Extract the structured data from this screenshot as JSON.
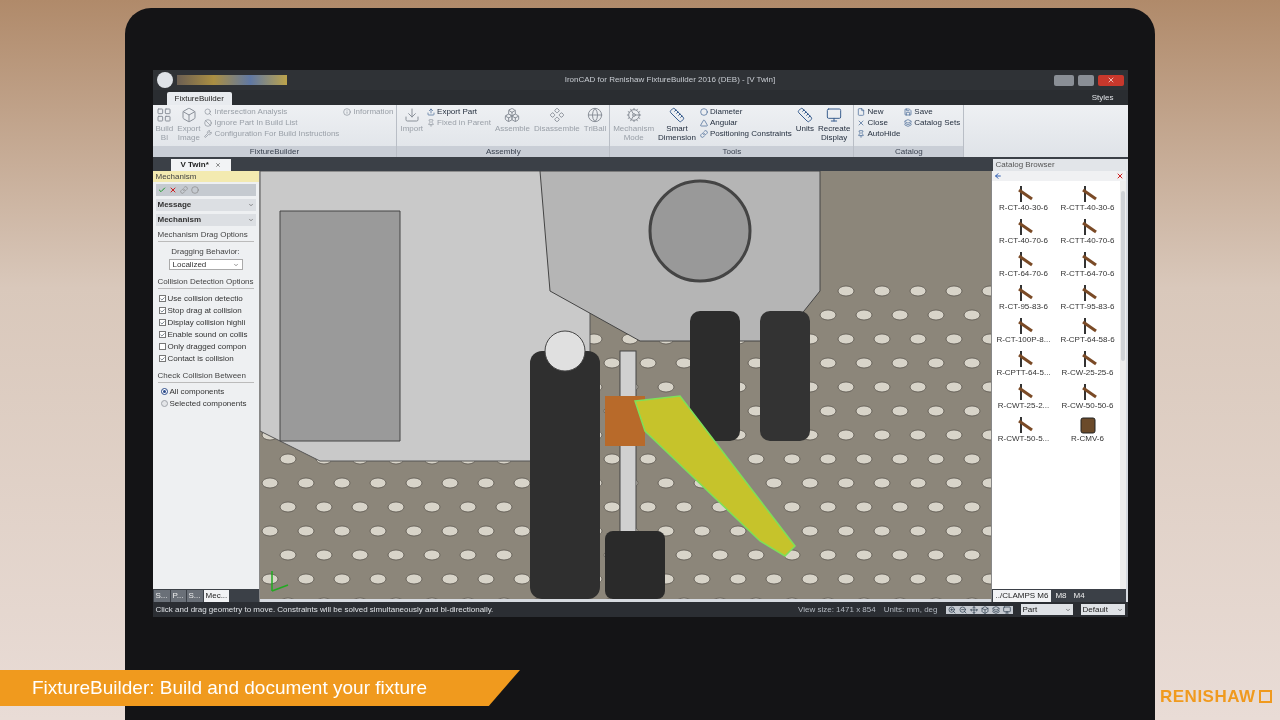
{
  "window": {
    "title": "IronCAD for Renishaw FixtureBuilder 2016 (DEB) - [V Twin]"
  },
  "ribbon": {
    "tabs": [
      {
        "label": "FixtureBuilder",
        "selected": true
      }
    ],
    "styles_label": "Styles",
    "groups": [
      {
        "label": "FixtureBuilder",
        "items": [
          {
            "kind": "large",
            "label": "Build\nBl",
            "disabled": true
          },
          {
            "kind": "large",
            "label": "Export\nImage",
            "disabled": true
          },
          {
            "kind": "small",
            "label": "Intersection Analysis",
            "disabled": true
          },
          {
            "kind": "small",
            "label": "Ignore Part In Build List",
            "disabled": true
          },
          {
            "kind": "small",
            "label": "Configuration For Build Instructions",
            "disabled": true
          },
          {
            "kind": "small",
            "label": "Information",
            "disabled": true
          }
        ]
      },
      {
        "label": "Assembly",
        "items": [
          {
            "kind": "large",
            "label": "Import",
            "disabled": true
          },
          {
            "kind": "small",
            "label": "Export Part",
            "disabled": false
          },
          {
            "kind": "small",
            "label": "Fixed in Parent",
            "disabled": true
          },
          {
            "kind": "large",
            "label": "Assemble",
            "disabled": true
          },
          {
            "kind": "large",
            "label": "Disassemble",
            "disabled": true
          },
          {
            "kind": "large",
            "label": "TriBall",
            "disabled": true
          }
        ]
      },
      {
        "label": "Tools",
        "items": [
          {
            "kind": "large",
            "label": "Mechanism\nMode",
            "disabled": true
          },
          {
            "kind": "large",
            "label": "Smart\nDimension",
            "disabled": false
          },
          {
            "kind": "small",
            "label": "Diameter",
            "disabled": false
          },
          {
            "kind": "small",
            "label": "Angular",
            "disabled": false
          },
          {
            "kind": "small",
            "label": "Positioning Constraints",
            "disabled": false
          },
          {
            "kind": "large",
            "label": "Units",
            "disabled": false
          },
          {
            "kind": "large",
            "label": "Recreate\nDisplay",
            "disabled": false
          }
        ]
      },
      {
        "label": "Catalog",
        "items": [
          {
            "kind": "small",
            "label": "New",
            "disabled": false
          },
          {
            "kind": "small",
            "label": "Close",
            "disabled": false
          },
          {
            "kind": "small",
            "label": "AutoHide",
            "disabled": false
          },
          {
            "kind": "small",
            "label": "Save",
            "disabled": false
          },
          {
            "kind": "small",
            "label": "Catalog Sets",
            "disabled": false
          }
        ]
      }
    ]
  },
  "document_tabs": [
    {
      "label": "V Twin*",
      "selected": true
    }
  ],
  "mechanism_panel": {
    "title": "Mechanism",
    "sections": [
      {
        "label": "Message"
      },
      {
        "label": "Mechanism"
      }
    ],
    "drag_options_heading": "Mechanism Drag Options",
    "dragging_behavior_label": "Dragging Behavior:",
    "dragging_behavior_value": "Localized",
    "collision_heading": "Collision Detection Options",
    "checkboxes": [
      {
        "label": "Use collision detectio",
        "checked": true
      },
      {
        "label": "Stop drag at collision",
        "checked": true
      },
      {
        "label": "Display collision highli",
        "checked": true
      },
      {
        "label": "Enable sound on collis",
        "checked": true
      },
      {
        "label": "Only dragged compon",
        "checked": false
      },
      {
        "label": "Contact is collision",
        "checked": true
      }
    ],
    "check_between_heading": "Check Collision Between",
    "radios": [
      {
        "label": "All components",
        "selected": true
      },
      {
        "label": "Selected components",
        "selected": false
      }
    ],
    "bottom_tabs": [
      {
        "label": "S...",
        "selected": false
      },
      {
        "label": "P...",
        "selected": false
      },
      {
        "label": "S...",
        "selected": false
      },
      {
        "label": "Mec...",
        "selected": true
      }
    ]
  },
  "catalog_browser": {
    "title": "Catalog Browser",
    "items": [
      {
        "label": "R-CT-40-30-6",
        "kind": "clamp"
      },
      {
        "label": "R-CTT-40-30-6",
        "kind": "clamp"
      },
      {
        "label": "R-CT-40-70-6",
        "kind": "clamp"
      },
      {
        "label": "R-CTT-40-70-6",
        "kind": "clamp"
      },
      {
        "label": "R-CT-64-70-6",
        "kind": "clamp"
      },
      {
        "label": "R-CTT-64-70-6",
        "kind": "clamp"
      },
      {
        "label": "R-CT-95-83-6",
        "kind": "clamp"
      },
      {
        "label": "R-CTT-95-83-6",
        "kind": "clamp"
      },
      {
        "label": "R-CT-100P-8...",
        "kind": "clamp"
      },
      {
        "label": "R-CPT-64-58-6",
        "kind": "clamp"
      },
      {
        "label": "R-CPTT-64-5...",
        "kind": "clamp"
      },
      {
        "label": "R-CW-25-25-6",
        "kind": "clamp"
      },
      {
        "label": "R-CWT-25-2...",
        "kind": "clamp"
      },
      {
        "label": "R-CW-50-50-6",
        "kind": "clamp"
      },
      {
        "label": "R-CWT-50-5...",
        "kind": "clamp"
      },
      {
        "label": "R-CMV-6",
        "kind": "block"
      }
    ],
    "tabs": [
      {
        "label": "../CLAMPS M6",
        "selected": true
      },
      {
        "label": "M8",
        "selected": false
      },
      {
        "label": "M4",
        "selected": false
      }
    ]
  },
  "status_bar": {
    "message": "Click and drag geometry to move.  Constraints will be solved simultaneously and bi-directionally.",
    "view_size": "View size: 1471 x 854",
    "units": "Units: mm, deg",
    "part_select": "Part",
    "default_select": "Default"
  },
  "banner": {
    "text": "FixtureBuilder: Build and document your fixture"
  },
  "logo": {
    "text": "RENISHAW"
  }
}
